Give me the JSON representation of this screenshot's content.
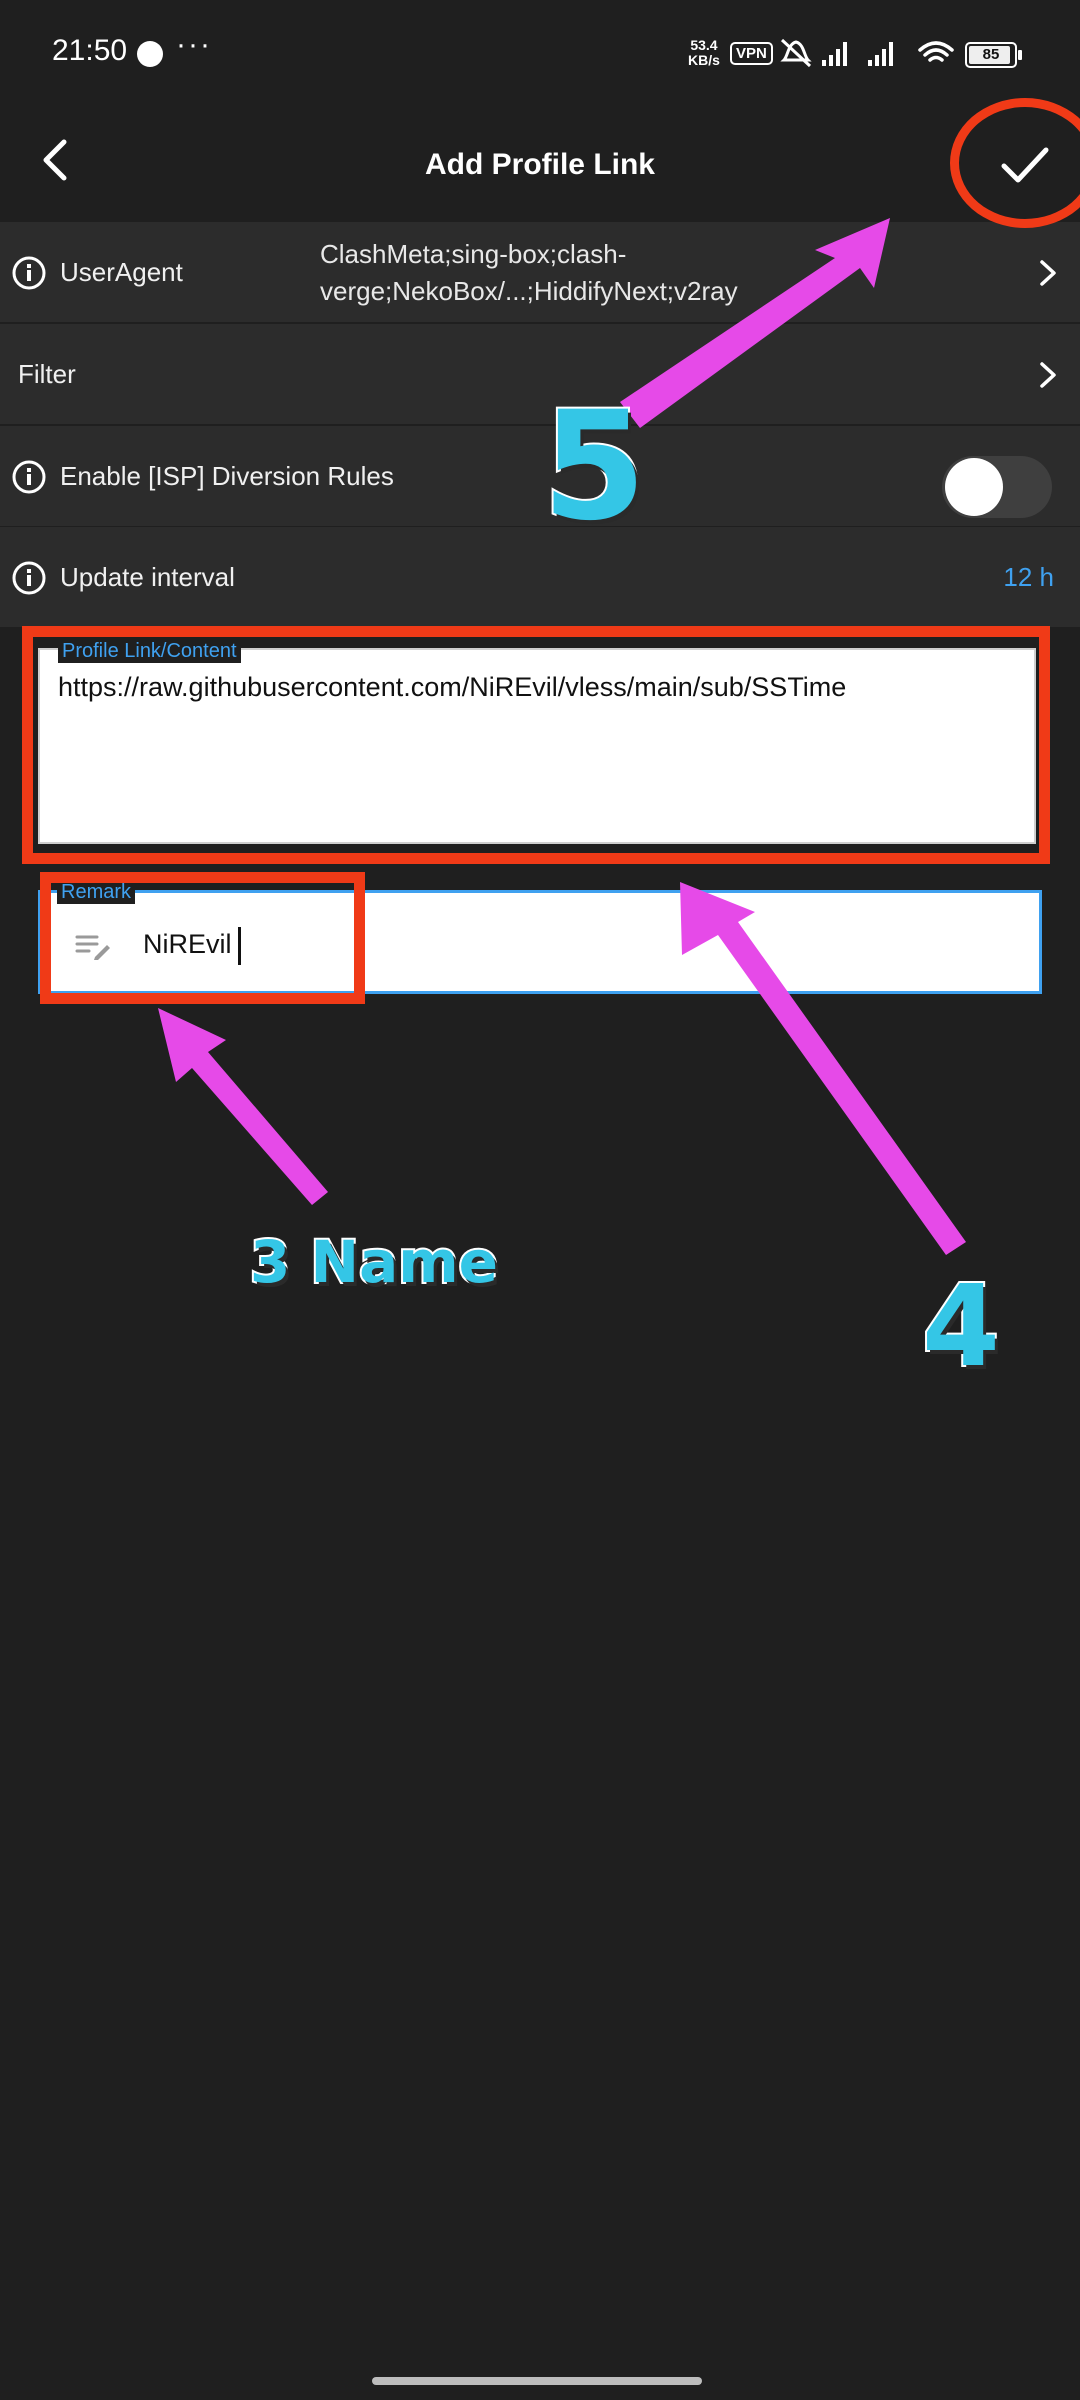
{
  "status_bar": {
    "time": "21:50",
    "more": "···",
    "net_speed": "53.4",
    "net_unit": "KB/s",
    "vpn": "VPN",
    "battery": "85"
  },
  "appbar": {
    "title": "Add Profile Link"
  },
  "rows": {
    "useragent": {
      "label": "UserAgent",
      "value": "ClashMeta;sing-box;clash-verge;NekoBox/...;HiddifyNext;v2ray"
    },
    "filter": {
      "label": "Filter"
    },
    "isp": {
      "label": "Enable [ISP] Diversion Rules",
      "enabled": false
    },
    "interval": {
      "label": "Update interval",
      "value": "12 h"
    }
  },
  "form": {
    "profile_link": {
      "label": "Profile Link/Content",
      "value": "https://raw.githubusercontent.com/NiREvil/vless/main/sub/SSTime"
    },
    "remark": {
      "label": "Remark",
      "value": "NiREvil"
    }
  },
  "annotations": {
    "step3": "3 Name",
    "step4": "4",
    "step5": "5",
    "annot_color": "#f03a17",
    "arrow_color": "#e64ae8",
    "number_color": "#34c6e6"
  },
  "colors": {
    "background": "#1f1f1f",
    "row": "#2c2c2c",
    "accent": "#3fa1f0"
  },
  "icons": [
    "back-icon",
    "check-icon",
    "info-icon",
    "chevron-right-icon",
    "notes-edit-icon"
  ]
}
